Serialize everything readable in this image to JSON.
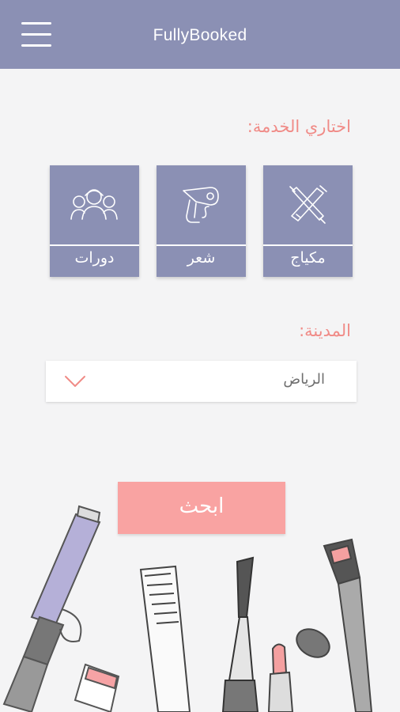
{
  "header": {
    "title": "FullyBooked",
    "menu_icon": "hamburger-menu-icon",
    "background": "#8b90b4"
  },
  "service": {
    "label": "اختاري الخدمة:",
    "tiles": [
      {
        "label": "مكياج",
        "icon": "makeup-brush-lipstick-icon"
      },
      {
        "label": "شعر",
        "icon": "hair-dryer-icon"
      },
      {
        "label": "دورات",
        "icon": "group-courses-icon"
      }
    ]
  },
  "city": {
    "label": "المدينة:",
    "selected": "الرياض",
    "icon": "chevron-down-icon"
  },
  "search": {
    "label": "ابحث",
    "color": "#f9a3a2"
  },
  "colors": {
    "accent_text": "#f08b87",
    "tile": "#8b90b4"
  }
}
